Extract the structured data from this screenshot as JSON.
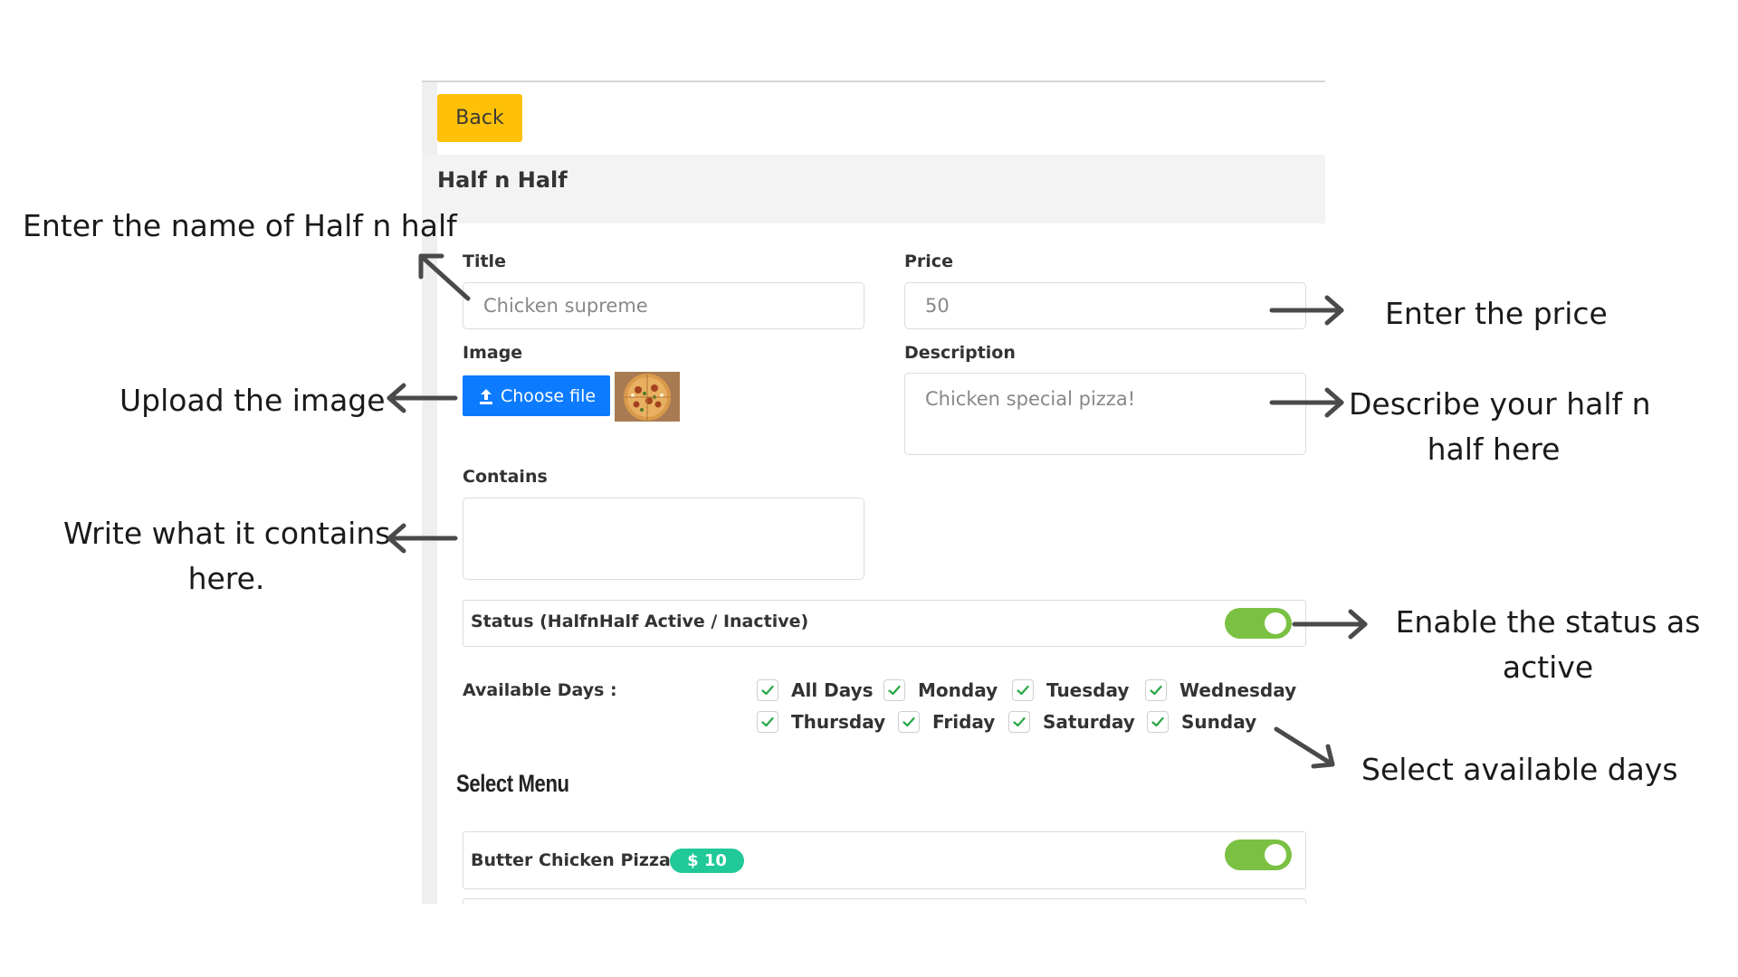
{
  "toolbar": {
    "back_label": "Back"
  },
  "section": {
    "title": "Half n Half"
  },
  "form": {
    "title_label": "Title",
    "title_value": "Chicken supreme",
    "price_label": "Price",
    "price_value": "50",
    "image_label": "Image",
    "choose_file_label": "Choose file",
    "description_label": "Description",
    "description_value": "Chicken special pizza!",
    "contains_label": "Contains",
    "contains_value": "",
    "status_label": "Status (HalfnHalf Active / Inactive)",
    "status_active": true,
    "available_days_label": "Available Days :",
    "days": [
      {
        "label": "All Days",
        "checked": true
      },
      {
        "label": "Monday",
        "checked": true
      },
      {
        "label": "Tuesday",
        "checked": true
      },
      {
        "label": "Wednesday",
        "checked": true
      },
      {
        "label": "Thursday",
        "checked": true
      },
      {
        "label": "Friday",
        "checked": true
      },
      {
        "label": "Saturday",
        "checked": true
      },
      {
        "label": "Sunday",
        "checked": true
      }
    ]
  },
  "select_menu": {
    "title": "Select Menu",
    "items": [
      {
        "name": "Butter Chicken Pizza",
        "price": "$ 10",
        "enabled": true
      }
    ]
  },
  "annotations": {
    "name": "Enter the name of Half n half",
    "price": "Enter the price",
    "image": "Upload the image",
    "description_line1": "Describe your half n",
    "description_line2": "half here",
    "contains_line1": "Write what it contains",
    "contains_line2": "here.",
    "status_line1": "Enable the status as",
    "status_line2": "active",
    "days": "Select available days"
  },
  "colors": {
    "back_button": "#ffc107",
    "choose_file": "#0d7bff",
    "toggle_on": "#7ac143",
    "check": "#28a745",
    "badge": "#20c997"
  }
}
